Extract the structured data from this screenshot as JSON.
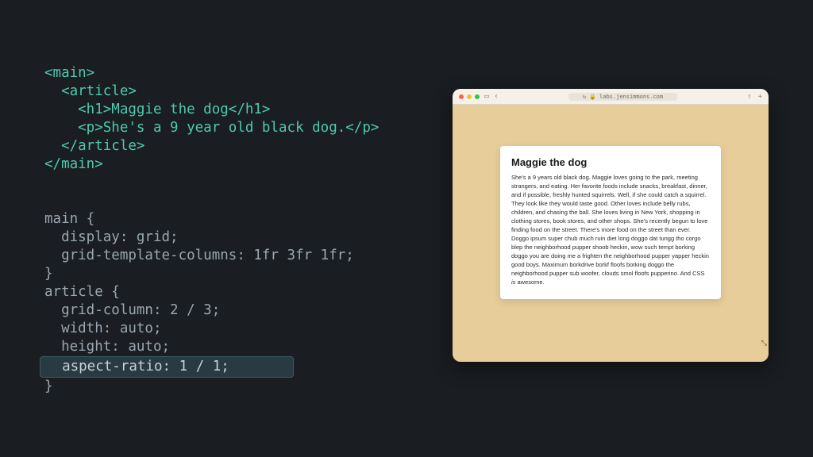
{
  "code": {
    "html_lines": [
      "<main>",
      "  <article>",
      "    <h1>Maggie the dog</h1>",
      "    <p>She's a 9 year old black dog.</p>",
      "  </article>",
      "</main>"
    ],
    "css_block1_selector": "main {",
    "css_block1_props": [
      "  display: grid;",
      "  grid-template-columns: 1fr 3fr 1fr;"
    ],
    "css_block1_close": "}",
    "css_block2_selector": "article {",
    "css_block2_props": [
      "  grid-column: 2 / 3;",
      "  width: auto;",
      "  height: auto;"
    ],
    "css_block2_highlight": "  aspect-ratio: 1 / 1;",
    "css_block2_close": "}"
  },
  "browser": {
    "url_host": "labs.jensimmons.com",
    "lock_icon": "🔒",
    "reload_icon": "↻",
    "back_icon": "‹",
    "sidebar_icon": "▭",
    "share_icon": "⇧",
    "plus_icon": "+",
    "card_title": "Maggie the dog",
    "card_paragraph_pre_em": "She's a 9 years old black dog. Maggie loves going to the park, meeting strangers, and eating. Her favorite foods include snacks, breakfast, dinner, and if possible, freshly hunted squirrels. Well, if she could catch a squirrel. They look like they would taste good. Other loves include belly rubs, children, and chasing the ball. She loves living in New York, shopping in clothing stores, book stores, and other shops. She's recently begun to love finding food on the street. There's more food on the street than ever. Doggo ipsum super chub much ruin diet long doggo dat tungg tho corgo blep the neighborhood pupper shoob heckin, wow such tempt borking doggo you are doing me a frighten the neighborhood pupper yapper heckin good boys. Maximum borkdrive borkf floofs borking doggo the neighborhood pupper sub woofer, clouds smol floofs pupperino. And CSS ",
    "card_paragraph_em": "is",
    "card_paragraph_post_em": " awesome."
  }
}
